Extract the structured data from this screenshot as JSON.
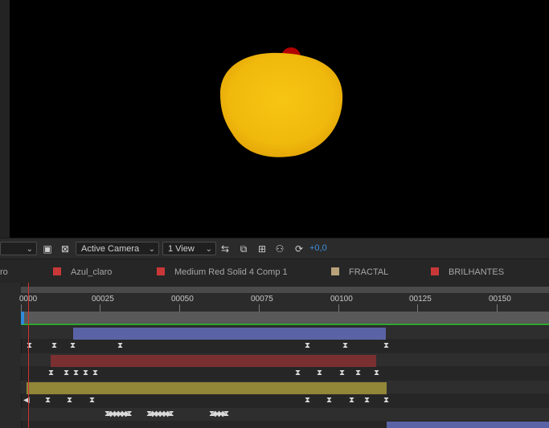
{
  "viewer": {
    "zoom_value": "",
    "camera": "Active Camera",
    "view": "1 View",
    "exposure": "+0,0",
    "colors": {
      "accent": "#3c8fdc",
      "background": "#000000",
      "shape": "#f2c010",
      "dot": "#b00000"
    }
  },
  "layer_tabs": [
    {
      "label": "ro",
      "color": ""
    },
    {
      "label": "Azul_claro",
      "color": "#c83838"
    },
    {
      "label": "Medium Red Solid 4 Comp 1",
      "color": "#c83838"
    },
    {
      "label": "FRACTAL",
      "color": "#b9a27a"
    },
    {
      "label": "BRILHANTES",
      "color": "#c83838"
    }
  ],
  "ruler": {
    "labels": [
      "0000",
      "00025",
      "00050",
      "00075",
      "00100",
      "00125",
      "00150"
    ]
  },
  "layers": [
    {
      "name": "layer-bar-blue",
      "color": "#5a63a6",
      "start": 14,
      "end": 114
    },
    {
      "name": "layer-bar-red",
      "color": "#7a3030",
      "start": 8,
      "end": 111
    },
    {
      "name": "layer-bar-olive",
      "color": "#928639",
      "start": 0,
      "end": 114
    },
    {
      "name": "layer-bar-blue-2",
      "color": "#5a63a6",
      "start": 114,
      "end": 160
    }
  ]
}
